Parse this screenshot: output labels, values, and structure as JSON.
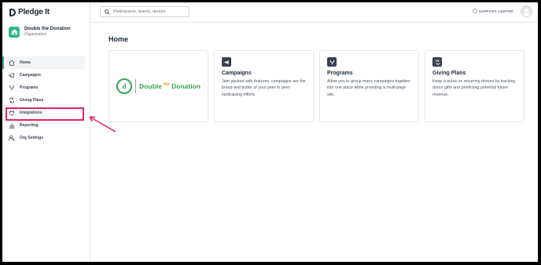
{
  "app": {
    "brand": "Pledge It"
  },
  "org": {
    "name": "Double the Donation",
    "role": "Organization"
  },
  "search": {
    "placeholder": "Participants, teams, donors"
  },
  "topbar": {
    "support_label": "SUPPORT CENTER"
  },
  "sidebar": {
    "items": [
      {
        "label": "Home",
        "icon": "home-icon",
        "active": true
      },
      {
        "label": "Campaigns",
        "icon": "megaphone-icon"
      },
      {
        "label": "Programs",
        "icon": "branch-icon"
      },
      {
        "label": "Giving Plans",
        "icon": "repeat-icon"
      },
      {
        "label": "Integrations",
        "icon": "plug-icon"
      },
      {
        "label": "Reporting",
        "icon": "chart-icon"
      },
      {
        "label": "Org Settings",
        "icon": "user-settings-icon"
      }
    ]
  },
  "main": {
    "title": "Home",
    "logo_card": {
      "brand_mark": "d",
      "brand_text_1": "Double",
      "brand_the": "the",
      "brand_text_2": "Donation"
    },
    "cards": [
      {
        "title": "Campaigns",
        "icon": "megaphone-icon",
        "description": "Jam packed with features, campaigns are the bread and butter of your peer to peer fundraising efforts."
      },
      {
        "title": "Programs",
        "icon": "branch-icon",
        "description": "Allow you to group many campaigns together into one place while providing a multi-page site."
      },
      {
        "title": "Giving Plans",
        "icon": "repeat-icon",
        "description": "Keep a pulse on recurring donors by tracking donor gifts and predicting potential future revenue."
      }
    ]
  },
  "colors": {
    "accent": "#34b785",
    "highlight": "#e0245e",
    "text": "#1f2937"
  }
}
